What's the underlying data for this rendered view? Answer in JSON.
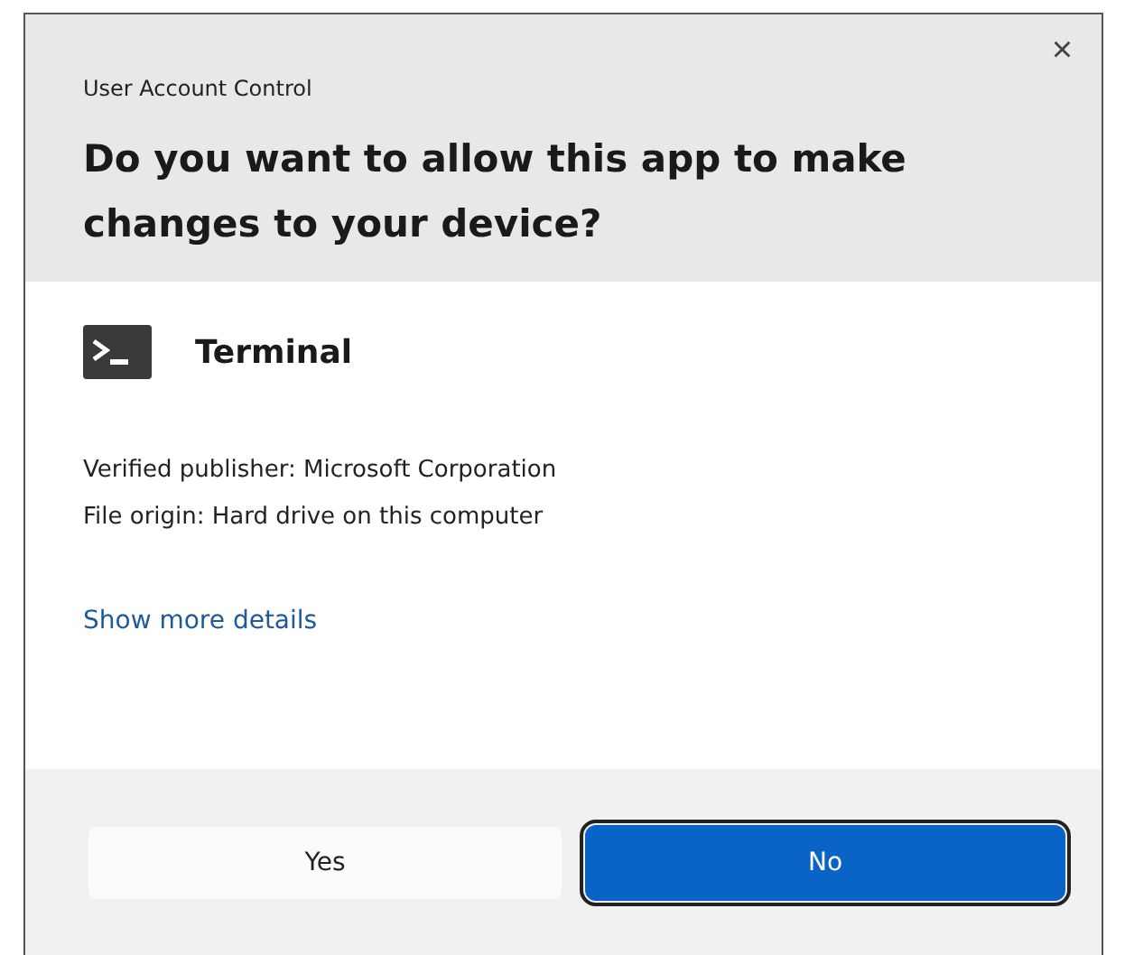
{
  "window": {
    "title": "User Account Control",
    "close": "×"
  },
  "question": "Do you want to allow this app to make changes to your device?",
  "app": {
    "name": "Terminal"
  },
  "details": [
    "Verified publisher: Microsoft Corporation",
    "File origin: Hard drive on this computer"
  ],
  "link": "Show more details",
  "buttons": [
    {
      "label": "Yes",
      "kind": "secondary",
      "focused": false
    },
    {
      "label": "No",
      "kind": "primary",
      "focused": true
    }
  ]
}
